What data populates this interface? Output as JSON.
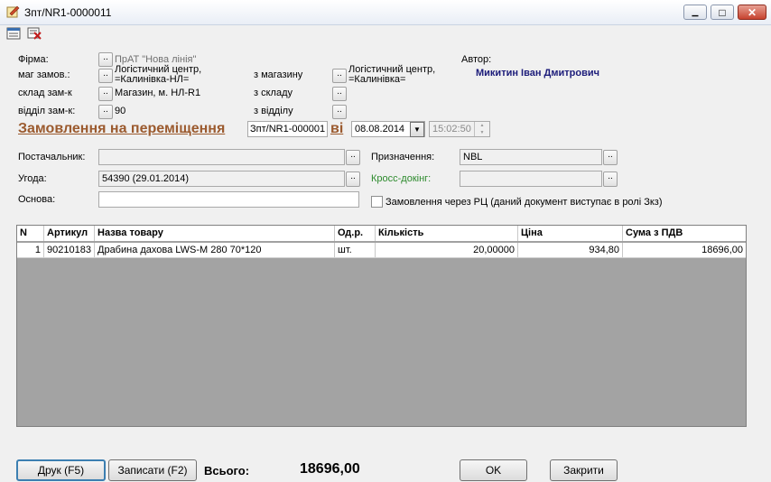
{
  "window": {
    "title": "Зпт/NR1-0000011",
    "minimize_glyph": "▁",
    "maximize_glyph": "□",
    "close_glyph": "✕"
  },
  "toolbar": {
    "icons": [
      "list-icon",
      "delete-icon"
    ]
  },
  "header": {
    "firma_label": "Фірма:",
    "firma_value": "ПрАТ \"Нова лінія\"",
    "mag_label": "маг замов.:",
    "mag_value_line1": "Логістичний центр,",
    "mag_value_line2": "=Калинівка-НЛ=",
    "sklad_label": "склад зам-к",
    "sklad_value": "Магазин, м. НЛ-R1",
    "viddil_label": "відділ зам-к:",
    "viddil_value": "90",
    "z_mag_label": "з магазину",
    "z_mag_value_line1": "Логістичний центр,",
    "z_mag_value_line2": "=Калинівка=",
    "z_sklad_label": "з складу",
    "z_viddil_label": "з відділу",
    "author_label": "Автор:",
    "author_name": "Микитин Іван Дмитрович",
    "dot_label": "..",
    "heading": "Замовлення на переміщення",
    "doc_number": "Зпт/NR1-000001",
    "vid_label": "ві",
    "date": "08.08.2014",
    "time": "15:02:50",
    "dropdown_glyph": "▼",
    "spin_up": "▲",
    "spin_down": "▼"
  },
  "form": {
    "postachalnyk_label": "Постачальник:",
    "postachalnyk_value": "",
    "uhoda_label": "Угода:",
    "uhoda_value": "54390 (29.01.2014)",
    "osnova_label": "Основа:",
    "osnova_value": "",
    "pryznachennia_label": "Призначення:",
    "pryznachennia_value": "NBL",
    "cross_label": "Кросс-докінг:",
    "cross_value": "",
    "rc_checkbox_label": "Замовлення через РЦ (даний документ виступає в ролі Зкз)"
  },
  "table": {
    "columns": [
      "N",
      "Артикул",
      "Назва товару",
      "Од.р.",
      "Кількість",
      "Ціна",
      "Сума з ПДВ"
    ],
    "rows": [
      [
        "1",
        "90210183",
        "Драбина дахова LWS-M 280 70*120",
        "шт.",
        "20,00000",
        "934,80",
        "18696,00"
      ]
    ]
  },
  "footer": {
    "print_button": "Друк (F5)",
    "save_button": "Записати (F2)",
    "total_label": "Всього:",
    "total_value": "18696,00",
    "ok_button": "OK",
    "close_button": "Закрити"
  }
}
